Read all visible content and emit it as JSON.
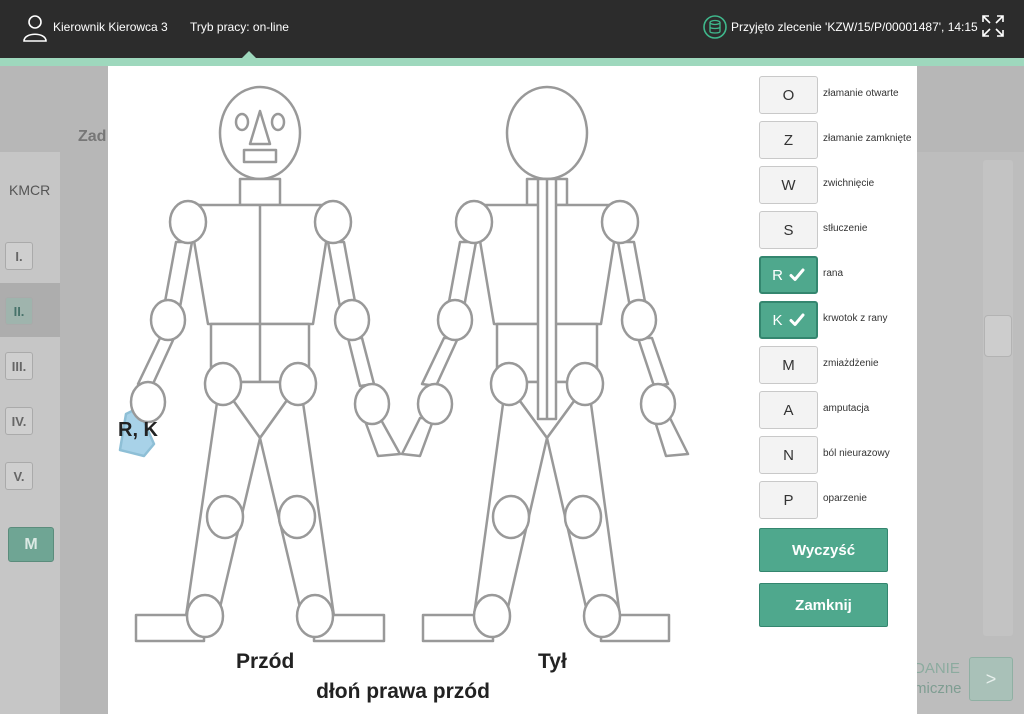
{
  "topbar": {
    "user_name": "Kierownik Kierowca 3",
    "work_mode": "Tryb pracy: on-line",
    "status_message": "Przyjęto zlecenie 'KZW/15/P/00001487', 14:15",
    "icons": [
      "user-icon",
      "database-icon",
      "fullscreen-icon"
    ]
  },
  "background": {
    "tab_label": "Zad",
    "section_label": "KMCR",
    "roman_items": [
      "I.",
      "II.",
      "III.",
      "IV.",
      "V."
    ],
    "m_button": "M",
    "right_text_1": "DANIE",
    "right_text_2": "miczne",
    "next_button": ">"
  },
  "modal": {
    "front_label": "Przód",
    "back_label": "Tył",
    "selected_part": "dłoń prawa przód",
    "marker_label": "R, K",
    "injuries": [
      {
        "code": "O",
        "desc": "złamanie otwarte",
        "checked": false
      },
      {
        "code": "Z",
        "desc": "złamanie zamknięte",
        "checked": false
      },
      {
        "code": "W",
        "desc": "zwichnięcie",
        "checked": false
      },
      {
        "code": "S",
        "desc": "stłuczenie",
        "checked": false
      },
      {
        "code": "R",
        "desc": "rana",
        "checked": true
      },
      {
        "code": "K",
        "desc": "krwotok z rany",
        "checked": true
      },
      {
        "code": "M",
        "desc": "zmiażdżenie",
        "checked": false
      },
      {
        "code": "A",
        "desc": "amputacja",
        "checked": false
      },
      {
        "code": "N",
        "desc": "ból nieurazowy",
        "checked": false
      },
      {
        "code": "P",
        "desc": "oparzenie",
        "checked": false
      }
    ],
    "clear_button": "Wyczyść",
    "close_button": "Zamknij"
  },
  "colors": {
    "accent": "#4fa88d",
    "topbar": "#2c2c2c",
    "topbar_accent": "#9ed8bd",
    "marker_fill": "#a8d2e8"
  }
}
